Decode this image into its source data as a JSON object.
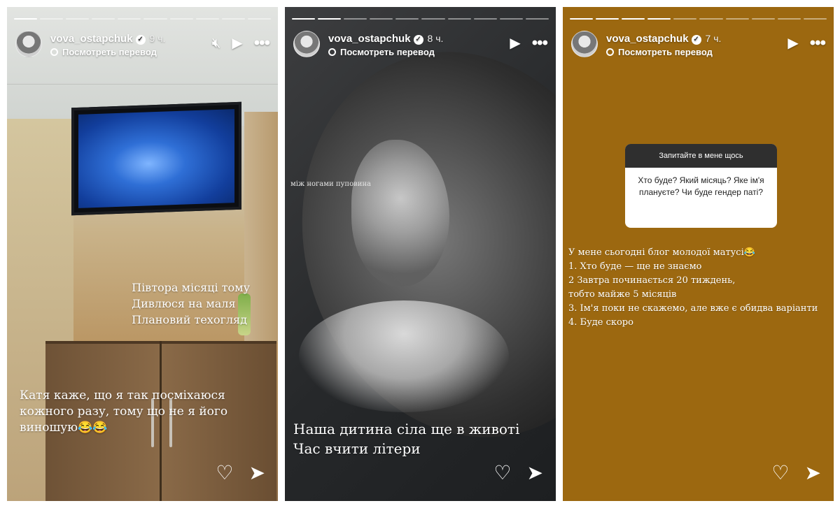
{
  "stories": [
    {
      "username": "vova_ostapchuk",
      "time": "9 ч.",
      "translate": "Посмотреть перевод",
      "caption_right": [
        "Півтора місяці тому",
        "Дивлюся на маля",
        "Плановий техогляд"
      ],
      "caption_bottom": [
        "Катя каже, що я так посміхаюся",
        "кожного разу, тому що не я його",
        "виношую😂😂"
      ]
    },
    {
      "username": "vova_ostapchuk",
      "time": "8 ч.",
      "translate": "Посмотреть перевод",
      "small_text": "між ногами пуповина",
      "caption": [
        "Наша дитина сіла ще в животі",
        "Час вчити літери"
      ]
    },
    {
      "username": "vova_ostapchuk",
      "time": "7 ч.",
      "translate": "Посмотреть перевод",
      "question_header": "Запитайте в мене щось",
      "question": "Хто буде? Який місяць? Яке ім'я плануєте? Чи буде гендер паті?",
      "answers": [
        "У мене сьогодні блог молодої матусі😂",
        "1. Хто буде — ще не знаємо",
        "2 Завтра починається 20 тиждень,",
        "тобто майже 5 місяців",
        "3. Ім'я поки не скажемо, але вже є обидва варіанти",
        "4. Буде скоро"
      ]
    }
  ],
  "icons": {
    "mute": "speaker-off-icon",
    "play": "play-icon",
    "more": "more-dots-icon",
    "like": "heart-icon",
    "share": "send-icon",
    "verified": "verified-badge-icon",
    "translate": "globe-icon"
  },
  "colors": {
    "story3_bg": "#9c6810",
    "question_header_bg": "#2f2f2f"
  }
}
